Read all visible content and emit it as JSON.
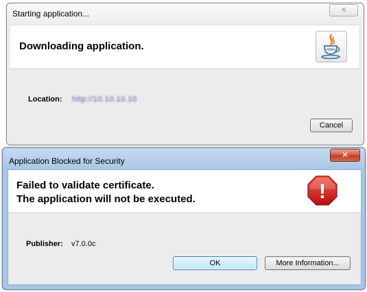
{
  "download_window": {
    "title": "Starting application...",
    "heading": "Downloading application.",
    "location_label": "Location:",
    "location_value": "http://10.10.10.10",
    "cancel_label": "Cancel",
    "close_symbol": "✕",
    "icon": "java-logo-icon"
  },
  "security_window": {
    "title": "Application Blocked for Security",
    "heading_line1": "Failed to validate certificate.",
    "heading_line2": "The application will not be executed.",
    "publisher_label": "Publisher:",
    "publisher_value": "v7.0.0c",
    "ok_label": "OK",
    "more_info_label": "More Information...",
    "close_symbol": "✕",
    "icon": "warning-stop-icon",
    "warning_sign_text": "!"
  },
  "colors": {
    "security_titlebar": "#aac7e6",
    "close_button_red": "#c13a23",
    "warning_red": "#d71e1e"
  }
}
